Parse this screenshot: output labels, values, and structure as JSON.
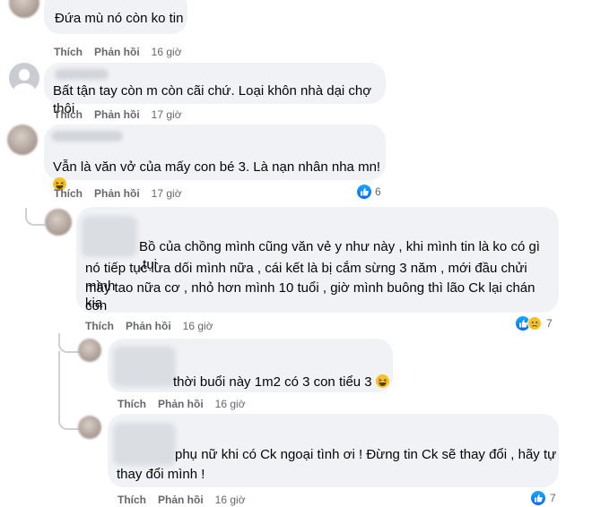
{
  "actions": {
    "like": "Thích",
    "reply": "Phản hồi"
  },
  "comments": [
    {
      "text": "Đứa mù nó còn ko tin",
      "time": "16 giờ"
    },
    {
      "text": "Bất tận tay còn m còn cãi chứ. Loại khôn nhà dại chợ thôi",
      "time": "17 giờ"
    },
    {
      "text": "Vẫn là văn vở của mấy con bé 3. Là nạn nhân nha mn!",
      "time": "17 giờ",
      "reactions": "6"
    },
    {
      "text_lines": [
        "Bồ của chồng mình cũng văn vẻ y như này , khi mình tin là ko có gì ,tụi",
        "nó tiếp tục lừa dối mình nữa , cái kết là bị cắm sừng 3 năm , mới đầu chửi mình",
        "mày tao nữa cơ , nhỏ hơn mình 10 tuổi , giờ mình buông thì lão Ck lại chán con",
        "kia"
      ],
      "time": "16 giờ",
      "reactions": "7"
    },
    {
      "text": "thời buổi này 1m2 có 3 con tiểu 3",
      "time": "16 giờ"
    },
    {
      "text_lines": [
        "phụ nữ khi có Ck ngoại tình ơi ! Đừng tin Ck sẽ thay đổi , hãy tự",
        "thay đổi mình !"
      ],
      "time": "16 giờ",
      "reactions": "7"
    }
  ],
  "colors": {
    "bubble": "#f0f2f5",
    "secondary_text": "#65676b",
    "like_blue": "#0866ff",
    "thread_line": "#ced0d4"
  },
  "icons": [
    "like-reaction-icon",
    "sad-reaction-icon",
    "laughing-emoji-icon"
  ]
}
